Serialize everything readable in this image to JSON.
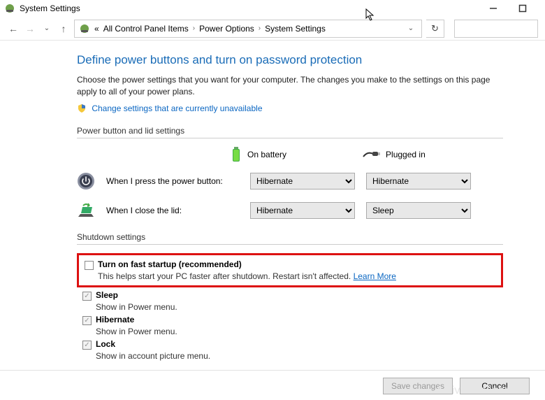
{
  "window": {
    "title": "System Settings"
  },
  "breadcrumb": {
    "prefix_glyph": "«",
    "items": [
      "All Control Panel Items",
      "Power Options",
      "System Settings"
    ]
  },
  "main": {
    "heading": "Define power buttons and turn on password protection",
    "description": "Choose the power settings that you want for your computer. The changes you make to the settings on this page apply to all of your power plans.",
    "change_link": "Change settings that are currently unavailable"
  },
  "section_power": {
    "label": "Power button and lid settings",
    "col_battery": "On battery",
    "col_plugged": "Plugged in",
    "rows": [
      {
        "label": "When I press the power button:",
        "battery": "Hibernate",
        "plugged": "Hibernate"
      },
      {
        "label": "When I close the lid:",
        "battery": "Hibernate",
        "plugged": "Sleep"
      }
    ]
  },
  "section_shutdown": {
    "label": "Shutdown settings",
    "fast": {
      "label": "Turn on fast startup (recommended)",
      "desc": "This helps start your PC faster after shutdown. Restart isn't affected.",
      "learn": "Learn More"
    },
    "sleep": {
      "label": "Sleep",
      "desc": "Show in Power menu."
    },
    "hibernate": {
      "label": "Hibernate",
      "desc": "Show in Power menu."
    },
    "lock": {
      "label": "Lock",
      "desc": "Show in account picture menu."
    }
  },
  "buttons": {
    "save": "Save changes",
    "cancel": "Cancel"
  },
  "watermark": "Activate Windows"
}
